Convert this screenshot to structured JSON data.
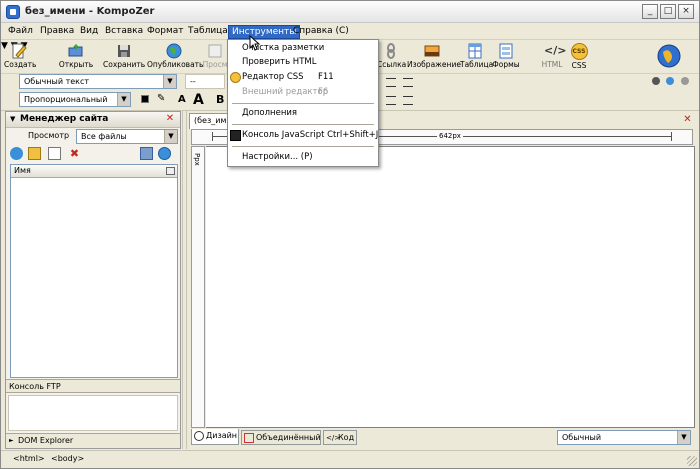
{
  "window": {
    "title": "без_имени - KompoZer",
    "btn_min": "_",
    "btn_max": "□",
    "btn_close": "×"
  },
  "menubar": [
    "Файл",
    "Правка",
    "Вид",
    "Вставка",
    "Формат",
    "Таблица",
    "Инструменты",
    "Справка (С)"
  ],
  "toolbar1": {
    "create": "Создать",
    "open": "Открыть",
    "save": "Сохранить",
    "publish": "Опубликовать",
    "preview": "Просм",
    "link": "Ссылка",
    "image": "Изображение",
    "table": "Таблица",
    "form": "Формы",
    "html": "HTML",
    "css": "CSS",
    "css_badge": "CSS",
    "html_badge": "</>"
  },
  "toolbar2": {
    "paragraph_format": "Обычный текст",
    "class_select": "--"
  },
  "toolbar3": {
    "font": "Пропорциональный",
    "bold": "B",
    "font_smaller": "A",
    "font_larger": "A"
  },
  "side_panel": {
    "title": "Менеджер сайта",
    "view_label": "Просмотр",
    "view_select": "Все файлы",
    "column": "Имя",
    "ftp": "Консоль FTP",
    "dom": "DOM Explorer"
  },
  "tab": {
    "label": "(без_имени)"
  },
  "ruler": {
    "width_label": "642px",
    "vertical_label": "Ppx"
  },
  "bottom_tabs": {
    "design": "Дизайн",
    "combined": "Объединённый",
    "code": "Код",
    "view_mode": "Обычный"
  },
  "statusbar": {
    "tag1": "<html>",
    "tag2": "<body>"
  },
  "dropdown": {
    "items": [
      {
        "label": "Очистка разметки",
        "shortcut": ""
      },
      {
        "label": "Проверить HTML",
        "shortcut": ""
      },
      {
        "label": "Редактор CSS",
        "shortcut": "F11"
      },
      {
        "label": "Внешний редактор",
        "shortcut": "F6"
      },
      {
        "label": "Дополнения",
        "shortcut": ""
      },
      {
        "label": "Консоль JavaScript Ctrl+Shift+J",
        "shortcut": ""
      },
      {
        "label": "Настройки... (Р)",
        "shortcut": ""
      }
    ]
  },
  "colors": {
    "menu_highlight": "#316ac5",
    "close_red": "#c3261c",
    "panel_bg": "#ece9d8"
  }
}
